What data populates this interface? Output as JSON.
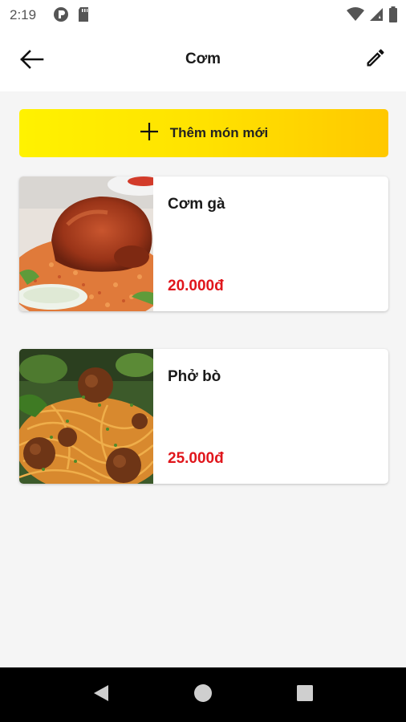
{
  "status_bar": {
    "time": "2:19",
    "left_icons": [
      "sync-icon",
      "sd-card-icon"
    ],
    "right_icons": [
      "wifi-icon",
      "cell-signal-icon",
      "battery-icon"
    ]
  },
  "app_bar": {
    "title": "Cơm",
    "back_icon": "arrow-left-icon",
    "edit_icon": "pencil-icon"
  },
  "add_button": {
    "label": "Thêm món mới",
    "icon": "plus-icon",
    "colors": [
      "#fff200",
      "#ffc800"
    ]
  },
  "items": [
    {
      "name": "Cơm gà",
      "price": "20.000đ",
      "image": "roast-chicken-rice-image"
    },
    {
      "name": "Phở bò",
      "price": "25.000đ",
      "image": "spaghetti-meatballs-image"
    }
  ],
  "colors": {
    "price": "#e0161c",
    "background": "#f5f5f5"
  },
  "nav_bar": {
    "buttons": [
      "back-triangle-icon",
      "home-circle-icon",
      "recents-square-icon"
    ]
  }
}
